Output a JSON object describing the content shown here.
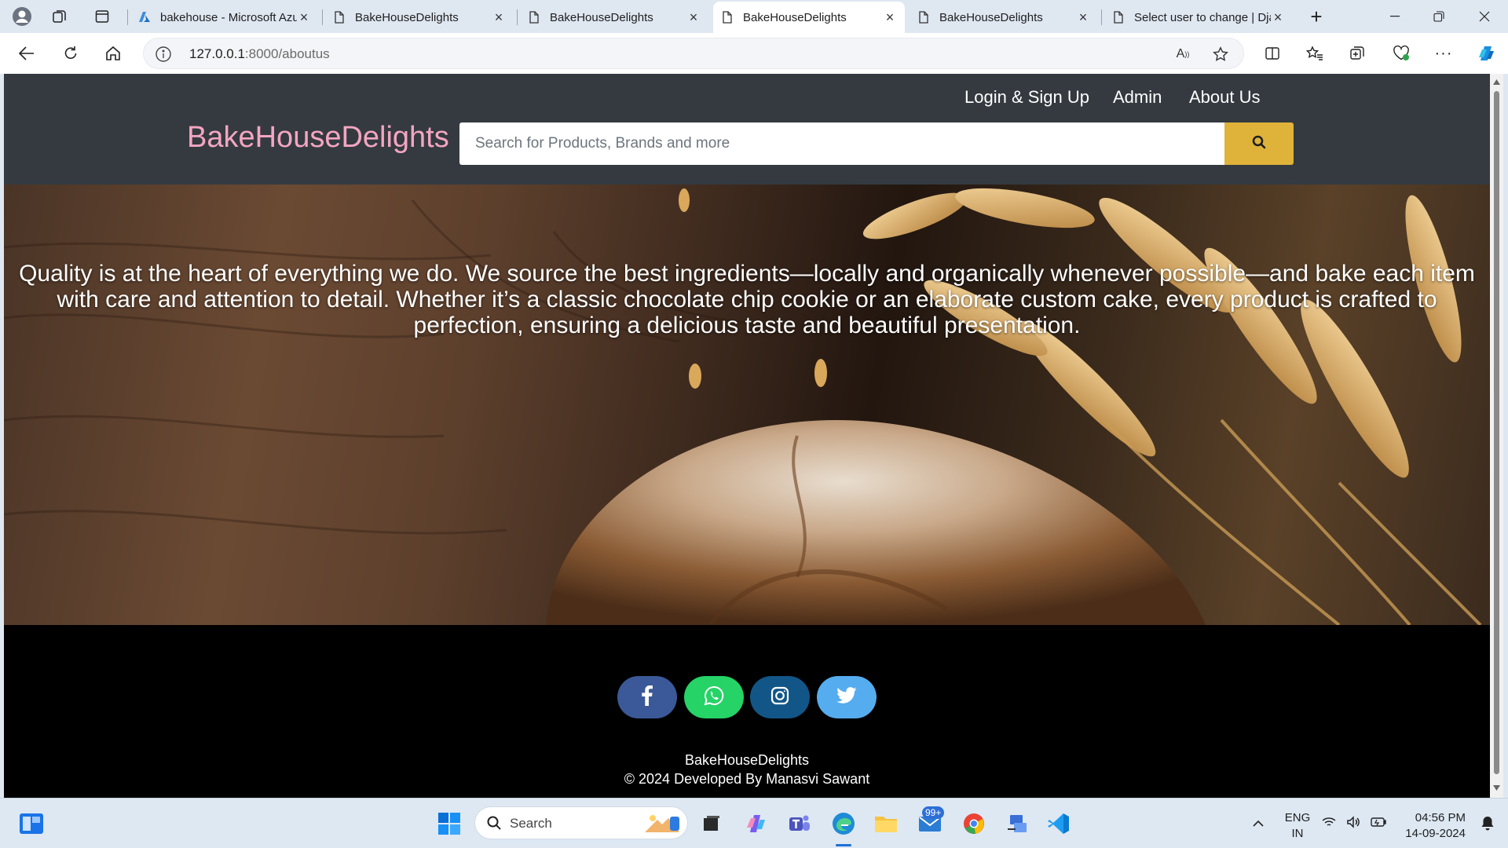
{
  "browser": {
    "tabs": [
      {
        "title": "bakehouse - Microsoft Azure",
        "active": false,
        "icon": "azure-icon"
      },
      {
        "title": "BakeHouseDelights",
        "active": false,
        "icon": "page-icon"
      },
      {
        "title": "BakeHouseDelights",
        "active": false,
        "icon": "page-icon"
      },
      {
        "title": "BakeHouseDelights",
        "active": true,
        "icon": "page-icon"
      },
      {
        "title": "BakeHouseDelights",
        "active": false,
        "icon": "page-icon"
      },
      {
        "title": "Select user to change | Django",
        "active": false,
        "icon": "page-icon"
      }
    ],
    "url_host": "127.0.0.1",
    "url_path": ":8000/aboutus"
  },
  "site": {
    "brand": "BakeHouseDelights",
    "nav": {
      "login": "Login & Sign Up",
      "admin": "Admin",
      "about": "About Us"
    },
    "search": {
      "placeholder": "Search for Products, Brands and more"
    },
    "hero_text": "Quality is at the heart of everything we do. We source the best ingredients—locally and organically whenever possible—and bake each item with care and attention to detail. Whether it’s a classic chocolate chip cookie or an elaborate custom cake, every product is crafted to perfection, ensuring a delicious taste and beautiful presentation.",
    "footer": {
      "brand": "BakeHouseDelights",
      "credit": "© 2024 Developed By Manasvi Sawant",
      "social": [
        {
          "name": "facebook",
          "color": "#3b5998"
        },
        {
          "name": "whatsapp",
          "color": "#25d366"
        },
        {
          "name": "instagram",
          "color": "#125688"
        },
        {
          "name": "twitter",
          "color": "#55acee"
        }
      ]
    }
  },
  "taskbar": {
    "search_label": "Search",
    "mail_badge": "99+",
    "lang_line1": "ENG",
    "lang_line2": "IN",
    "time": "04:56 PM",
    "date": "14-09-2024"
  },
  "colors": {
    "header_bg": "#343a40",
    "brand": "#f4a6c1",
    "search_button": "#dfb33a",
    "footer_bg": "#000000"
  }
}
